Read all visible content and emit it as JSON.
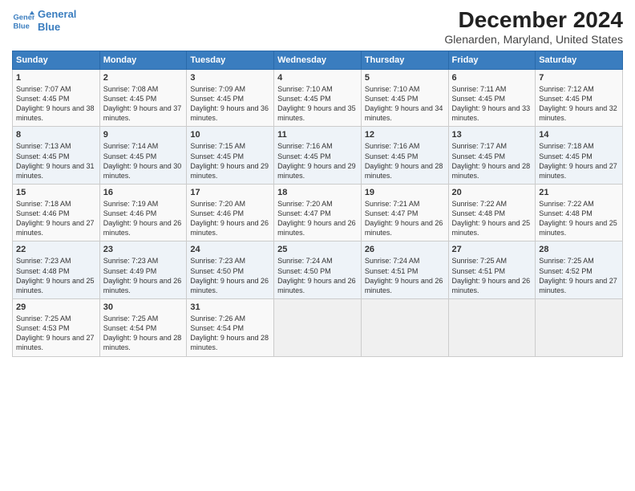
{
  "header": {
    "logo_line1": "General",
    "logo_line2": "Blue",
    "title": "December 2024",
    "subtitle": "Glenarden, Maryland, United States"
  },
  "columns": [
    "Sunday",
    "Monday",
    "Tuesday",
    "Wednesday",
    "Thursday",
    "Friday",
    "Saturday"
  ],
  "weeks": [
    [
      {
        "day": "1",
        "sunrise": "Sunrise: 7:07 AM",
        "sunset": "Sunset: 4:45 PM",
        "daylight": "Daylight: 9 hours and 38 minutes."
      },
      {
        "day": "2",
        "sunrise": "Sunrise: 7:08 AM",
        "sunset": "Sunset: 4:45 PM",
        "daylight": "Daylight: 9 hours and 37 minutes."
      },
      {
        "day": "3",
        "sunrise": "Sunrise: 7:09 AM",
        "sunset": "Sunset: 4:45 PM",
        "daylight": "Daylight: 9 hours and 36 minutes."
      },
      {
        "day": "4",
        "sunrise": "Sunrise: 7:10 AM",
        "sunset": "Sunset: 4:45 PM",
        "daylight": "Daylight: 9 hours and 35 minutes."
      },
      {
        "day": "5",
        "sunrise": "Sunrise: 7:10 AM",
        "sunset": "Sunset: 4:45 PM",
        "daylight": "Daylight: 9 hours and 34 minutes."
      },
      {
        "day": "6",
        "sunrise": "Sunrise: 7:11 AM",
        "sunset": "Sunset: 4:45 PM",
        "daylight": "Daylight: 9 hours and 33 minutes."
      },
      {
        "day": "7",
        "sunrise": "Sunrise: 7:12 AM",
        "sunset": "Sunset: 4:45 PM",
        "daylight": "Daylight: 9 hours and 32 minutes."
      }
    ],
    [
      {
        "day": "8",
        "sunrise": "Sunrise: 7:13 AM",
        "sunset": "Sunset: 4:45 PM",
        "daylight": "Daylight: 9 hours and 31 minutes."
      },
      {
        "day": "9",
        "sunrise": "Sunrise: 7:14 AM",
        "sunset": "Sunset: 4:45 PM",
        "daylight": "Daylight: 9 hours and 30 minutes."
      },
      {
        "day": "10",
        "sunrise": "Sunrise: 7:15 AM",
        "sunset": "Sunset: 4:45 PM",
        "daylight": "Daylight: 9 hours and 29 minutes."
      },
      {
        "day": "11",
        "sunrise": "Sunrise: 7:16 AM",
        "sunset": "Sunset: 4:45 PM",
        "daylight": "Daylight: 9 hours and 29 minutes."
      },
      {
        "day": "12",
        "sunrise": "Sunrise: 7:16 AM",
        "sunset": "Sunset: 4:45 PM",
        "daylight": "Daylight: 9 hours and 28 minutes."
      },
      {
        "day": "13",
        "sunrise": "Sunrise: 7:17 AM",
        "sunset": "Sunset: 4:45 PM",
        "daylight": "Daylight: 9 hours and 28 minutes."
      },
      {
        "day": "14",
        "sunrise": "Sunrise: 7:18 AM",
        "sunset": "Sunset: 4:45 PM",
        "daylight": "Daylight: 9 hours and 27 minutes."
      }
    ],
    [
      {
        "day": "15",
        "sunrise": "Sunrise: 7:18 AM",
        "sunset": "Sunset: 4:46 PM",
        "daylight": "Daylight: 9 hours and 27 minutes."
      },
      {
        "day": "16",
        "sunrise": "Sunrise: 7:19 AM",
        "sunset": "Sunset: 4:46 PM",
        "daylight": "Daylight: 9 hours and 26 minutes."
      },
      {
        "day": "17",
        "sunrise": "Sunrise: 7:20 AM",
        "sunset": "Sunset: 4:46 PM",
        "daylight": "Daylight: 9 hours and 26 minutes."
      },
      {
        "day": "18",
        "sunrise": "Sunrise: 7:20 AM",
        "sunset": "Sunset: 4:47 PM",
        "daylight": "Daylight: 9 hours and 26 minutes."
      },
      {
        "day": "19",
        "sunrise": "Sunrise: 7:21 AM",
        "sunset": "Sunset: 4:47 PM",
        "daylight": "Daylight: 9 hours and 26 minutes."
      },
      {
        "day": "20",
        "sunrise": "Sunrise: 7:22 AM",
        "sunset": "Sunset: 4:48 PM",
        "daylight": "Daylight: 9 hours and 25 minutes."
      },
      {
        "day": "21",
        "sunrise": "Sunrise: 7:22 AM",
        "sunset": "Sunset: 4:48 PM",
        "daylight": "Daylight: 9 hours and 25 minutes."
      }
    ],
    [
      {
        "day": "22",
        "sunrise": "Sunrise: 7:23 AM",
        "sunset": "Sunset: 4:48 PM",
        "daylight": "Daylight: 9 hours and 25 minutes."
      },
      {
        "day": "23",
        "sunrise": "Sunrise: 7:23 AM",
        "sunset": "Sunset: 4:49 PM",
        "daylight": "Daylight: 9 hours and 26 minutes."
      },
      {
        "day": "24",
        "sunrise": "Sunrise: 7:23 AM",
        "sunset": "Sunset: 4:50 PM",
        "daylight": "Daylight: 9 hours and 26 minutes."
      },
      {
        "day": "25",
        "sunrise": "Sunrise: 7:24 AM",
        "sunset": "Sunset: 4:50 PM",
        "daylight": "Daylight: 9 hours and 26 minutes."
      },
      {
        "day": "26",
        "sunrise": "Sunrise: 7:24 AM",
        "sunset": "Sunset: 4:51 PM",
        "daylight": "Daylight: 9 hours and 26 minutes."
      },
      {
        "day": "27",
        "sunrise": "Sunrise: 7:25 AM",
        "sunset": "Sunset: 4:51 PM",
        "daylight": "Daylight: 9 hours and 26 minutes."
      },
      {
        "day": "28",
        "sunrise": "Sunrise: 7:25 AM",
        "sunset": "Sunset: 4:52 PM",
        "daylight": "Daylight: 9 hours and 27 minutes."
      }
    ],
    [
      {
        "day": "29",
        "sunrise": "Sunrise: 7:25 AM",
        "sunset": "Sunset: 4:53 PM",
        "daylight": "Daylight: 9 hours and 27 minutes."
      },
      {
        "day": "30",
        "sunrise": "Sunrise: 7:25 AM",
        "sunset": "Sunset: 4:54 PM",
        "daylight": "Daylight: 9 hours and 28 minutes."
      },
      {
        "day": "31",
        "sunrise": "Sunrise: 7:26 AM",
        "sunset": "Sunset: 4:54 PM",
        "daylight": "Daylight: 9 hours and 28 minutes."
      },
      null,
      null,
      null,
      null
    ]
  ]
}
